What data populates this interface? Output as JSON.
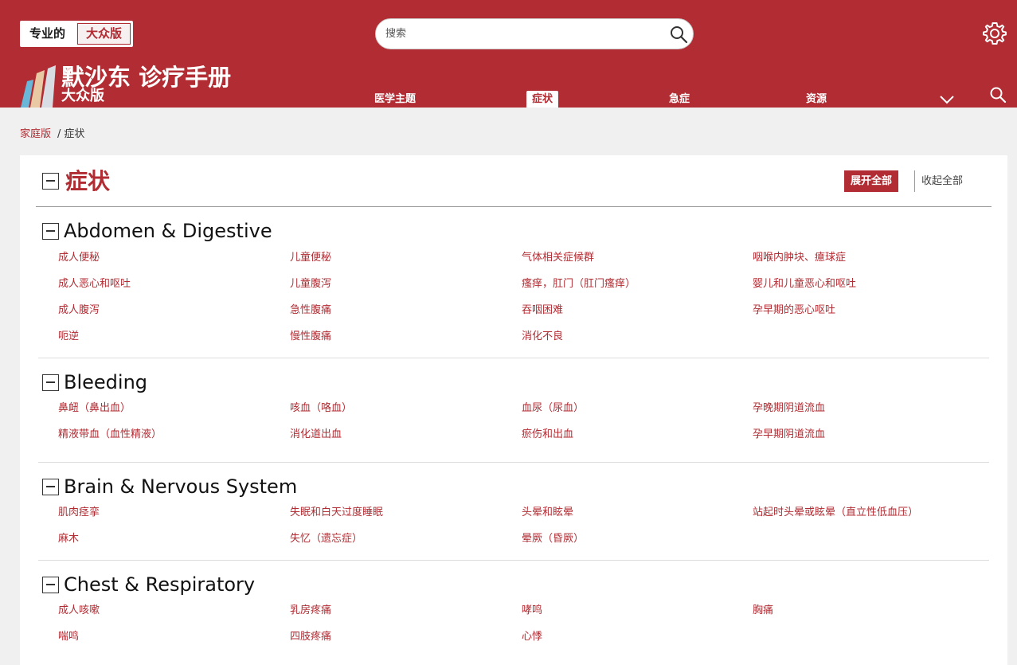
{
  "header": {
    "version_pro": "专业的",
    "version_consumer": "大众版",
    "search_placeholder": "搜索",
    "brand_title": "默沙东 诊疗手册",
    "brand_sub": "大众版",
    "nav": [
      "医学主题",
      "症状",
      "急症",
      "资源"
    ],
    "active_nav": "症状"
  },
  "breadcrumb": {
    "home": "家庭版",
    "separator": "/",
    "current": "症状"
  },
  "page": {
    "title": "症状",
    "expand_all": "展开全部",
    "collapse_all": "收起全部"
  },
  "sections": [
    {
      "title": "Abdomen & Digestive",
      "items": [
        [
          "成人便秘",
          "儿童便秘",
          "气体相关症候群",
          "咽喉内肿块、癔球症"
        ],
        [
          "成人恶心和呕吐",
          "儿童腹泻",
          "瘙痒，肛门（肛门瘙痒）",
          "婴儿和儿童恶心和呕吐"
        ],
        [
          "成人腹泻",
          "急性腹痛",
          "吞咽困难",
          "孕早期的恶心呕吐"
        ],
        [
          "呃逆",
          "慢性腹痛",
          "消化不良",
          ""
        ]
      ]
    },
    {
      "title": "Bleeding",
      "items": [
        [
          "鼻衄（鼻出血）",
          "咳血（咯血）",
          "血尿（尿血）",
          "孕晚期阴道流血"
        ],
        [
          "精液带血（血性精液）",
          "消化道出血",
          "瘀伤和出血",
          "孕早期阴道流血"
        ]
      ]
    },
    {
      "title": "Brain & Nervous System",
      "items": [
        [
          "肌肉痉挛",
          "失眠和白天过度睡眠",
          "头晕和眩晕",
          "站起时头晕或眩晕（直立性低血压）"
        ],
        [
          "麻木",
          "失忆（遗忘症）",
          "晕厥（昏厥）",
          ""
        ]
      ]
    },
    {
      "title": "Chest & Respiratory",
      "items": [
        [
          "成人咳嗽",
          "乳房疼痛",
          "哮鸣",
          "胸痛"
        ],
        [
          "喘鸣",
          "四肢疼痛",
          "心悸",
          ""
        ]
      ]
    }
  ],
  "colors": {
    "brand": "#b12c33",
    "white": "#ffffff",
    "page_bg": "#f0f0f0"
  },
  "icons": {
    "settings": "gear-icon",
    "search": "search-icon",
    "more": "chevron-down-icon",
    "toggle": "collapse-box-icon"
  }
}
